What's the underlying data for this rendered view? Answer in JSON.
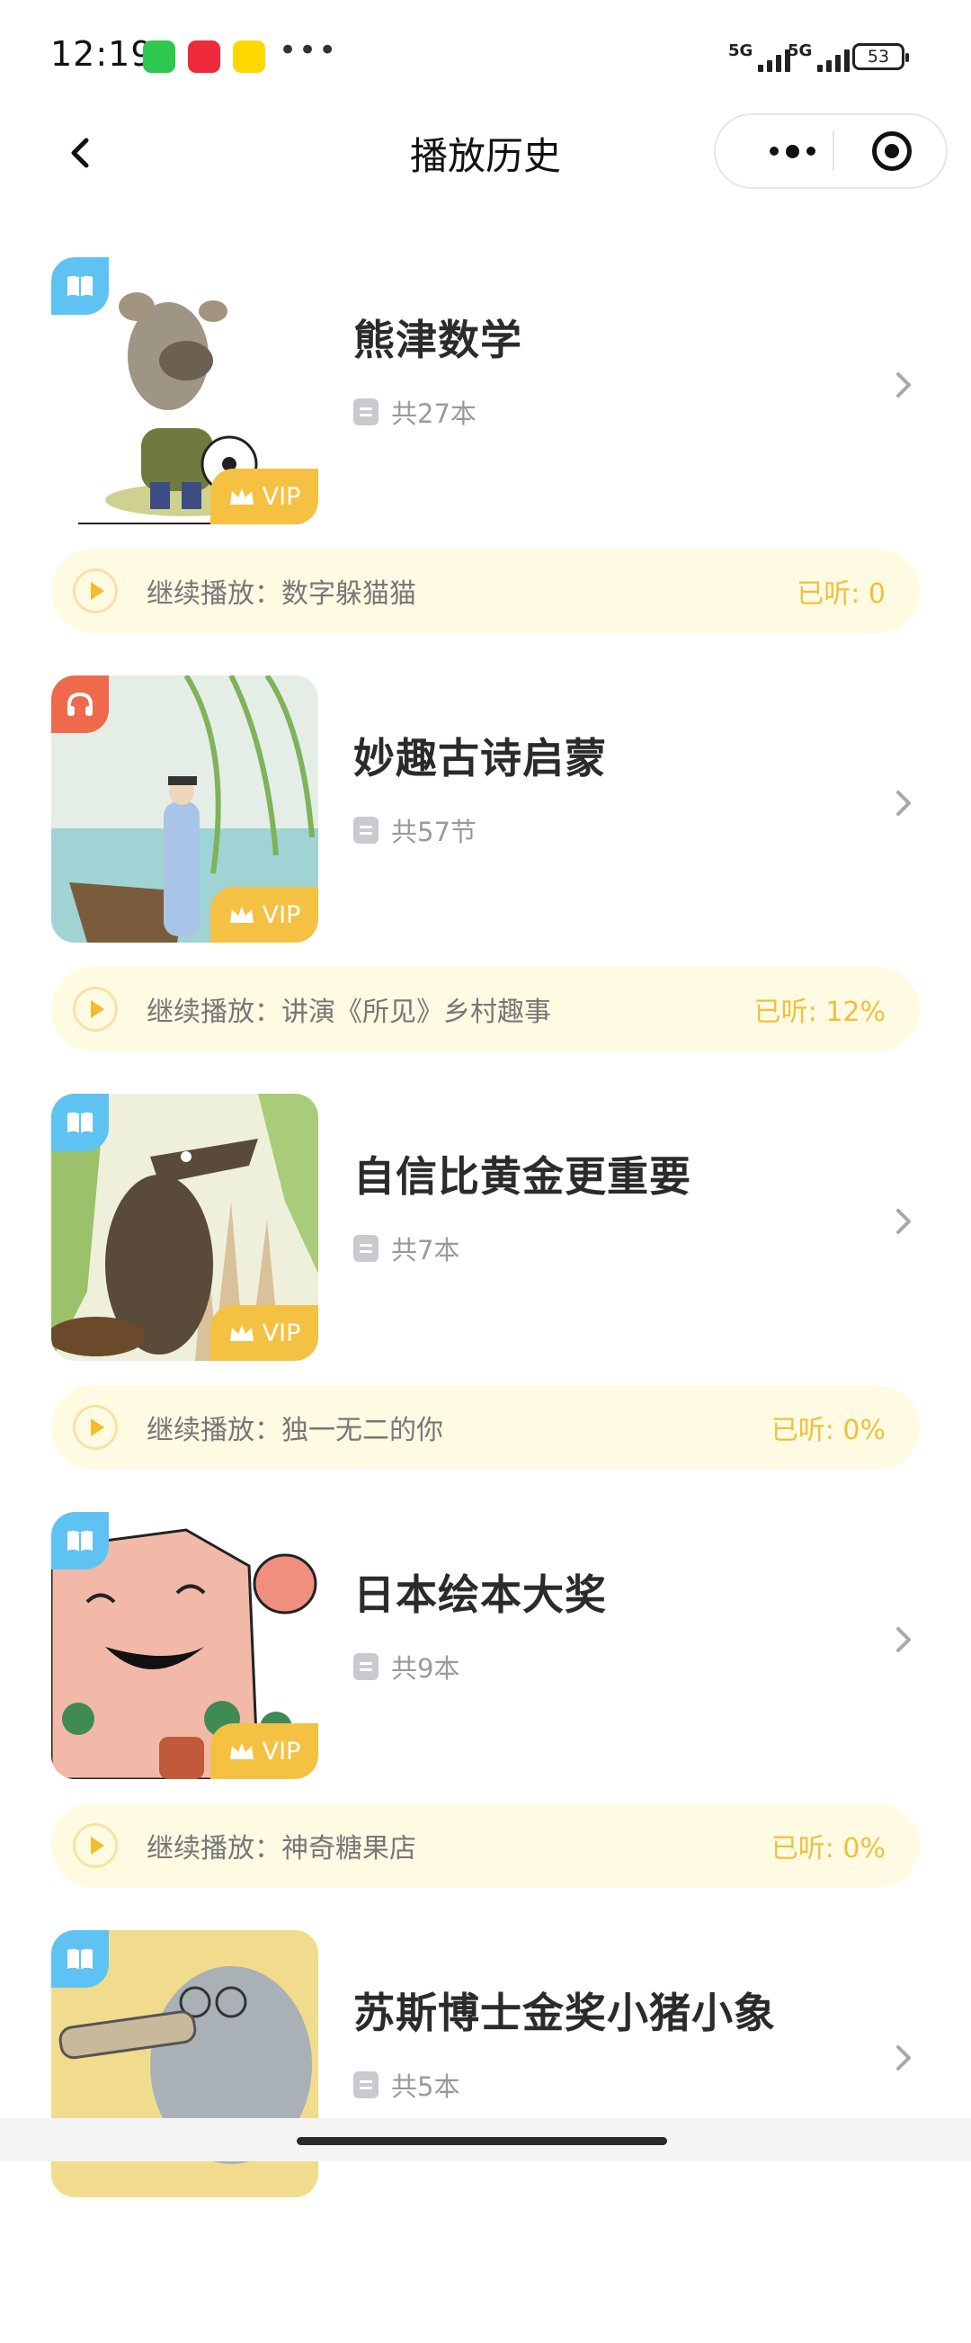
{
  "status_bar": {
    "time": "12:19",
    "app_icons": [
      "wechat-icon",
      "xiaohongshu-icon",
      "yellow-app-icon"
    ],
    "overflow": "•••",
    "signal_1_label": "5G",
    "signal_2_label": "5G",
    "battery": "53"
  },
  "nav": {
    "title": "播放历史",
    "back_icon": "chevron-left-icon",
    "more_icon": "more-dots-icon",
    "close_icon": "target-icon"
  },
  "items": [
    {
      "title": "熊津数学",
      "count": "共27本",
      "type": "book",
      "vip": "VIP",
      "resume": "继续播放：数字躲猫猫",
      "progress": "已听: 0"
    },
    {
      "title": "妙趣古诗启蒙",
      "count": "共57节",
      "type": "audio",
      "vip": "VIP",
      "resume": "继续播放：讲演《所见》乡村趣事",
      "progress": "已听: 12%"
    },
    {
      "title": "自信比黄金更重要",
      "count": "共7本",
      "type": "book",
      "vip": "VIP",
      "resume": "继续播放：独一无二的你",
      "progress": "已听: 0%"
    },
    {
      "title": "日本绘本大奖",
      "count": "共9本",
      "type": "book",
      "vip": "VIP",
      "resume": "继续播放：神奇糖果店",
      "progress": "已听: 0%"
    },
    {
      "title": "苏斯博士金奖小猪小象",
      "count": "共5本",
      "type": "book",
      "vip": "",
      "resume": "",
      "progress": ""
    }
  ],
  "colors": {
    "accent_yellow": "#f5c142",
    "resume_bg": "#fffbe3",
    "progress_text": "#f0c03c",
    "book_badge": "#5ec3f2",
    "audio_badge": "#ef6a4d"
  }
}
